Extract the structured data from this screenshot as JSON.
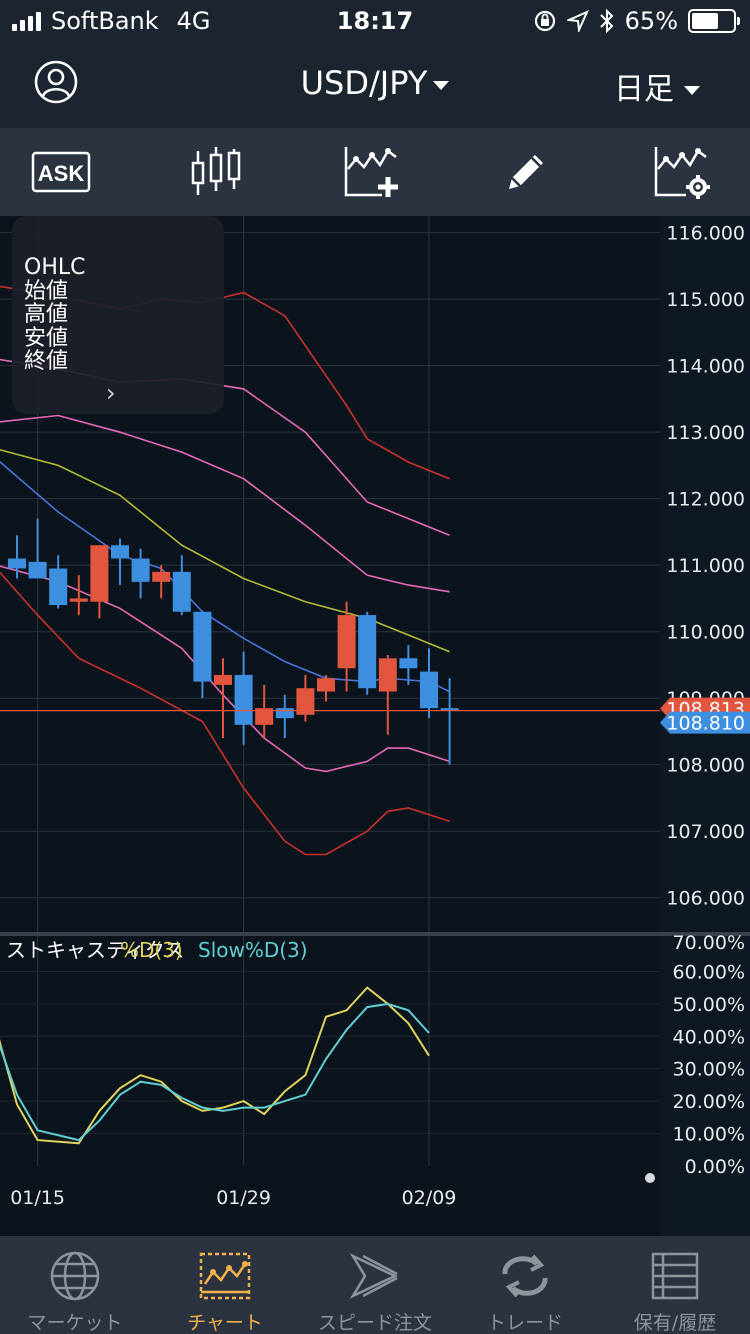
{
  "status_bar": {
    "carrier": "SoftBank",
    "network": "4G",
    "time": "18:17",
    "battery": "65%",
    "battery_level": 0.65
  },
  "header": {
    "pair": "USD/JPY",
    "period": "日足"
  },
  "toolbar": {
    "ask_label": "ASK",
    "tools": [
      "ask-icon",
      "candlestick-icon",
      "add-indicator-icon",
      "pencil-icon",
      "indicator-settings-icon"
    ]
  },
  "ohlc_panel": {
    "header": "OHLC",
    "rows": [
      "始値",
      "高値",
      "安値",
      "終値"
    ],
    "chevron": "›"
  },
  "stoch_legend": {
    "name": "ストキャスティクス",
    "d": "%D(3)",
    "slow": "Slow%D(3)"
  },
  "tabs": [
    {
      "label": "マーケット",
      "icon": "globe-icon"
    },
    {
      "label": "チャート",
      "icon": "chart-icon",
      "active": true
    },
    {
      "label": "スピード注文",
      "icon": "speed-order-icon"
    },
    {
      "label": "トレード",
      "icon": "trade-icon"
    },
    {
      "label": "保有/履歴",
      "icon": "positions-icon"
    }
  ],
  "colors": {
    "up": "#e2553f",
    "down": "#3d8fe0",
    "ma1": "#4a73d8",
    "ma2": "#b7ba36",
    "bollinger": "#e56ab9",
    "bollinger3": "#c9322c",
    "stoch_d": "#e0d35b",
    "stoch_slow": "#5fcfd3",
    "active_tab": "#f2b24b"
  },
  "chart_data": {
    "type": "candlestick",
    "price_axis": {
      "min": 105.5,
      "max": 116.25,
      "ticks": [
        "116.000",
        "115.000",
        "114.000",
        "113.000",
        "112.000",
        "111.000",
        "110.000",
        "109.000",
        "108.000",
        "107.000",
        "106.000"
      ]
    },
    "ask": "108.813",
    "bid": "108.810",
    "x_labels": [
      {
        "index": 1,
        "label": "01/15"
      },
      {
        "index": 11,
        "label": "01/29"
      },
      {
        "index": 20,
        "label": "02/09"
      }
    ],
    "candles": [
      {
        "o": 111.1,
        "h": 111.45,
        "l": 110.8,
        "c": 110.95
      },
      {
        "o": 111.05,
        "h": 111.7,
        "l": 110.8,
        "c": 110.8
      },
      {
        "o": 110.95,
        "h": 111.15,
        "l": 110.35,
        "c": 110.4
      },
      {
        "o": 110.45,
        "h": 110.85,
        "l": 110.25,
        "c": 110.5
      },
      {
        "o": 110.45,
        "h": 111.3,
        "l": 110.2,
        "c": 111.3
      },
      {
        "o": 111.3,
        "h": 111.4,
        "l": 110.7,
        "c": 111.1
      },
      {
        "o": 111.1,
        "h": 111.25,
        "l": 110.5,
        "c": 110.75
      },
      {
        "o": 110.75,
        "h": 111.0,
        "l": 110.5,
        "c": 110.9
      },
      {
        "o": 110.9,
        "h": 111.15,
        "l": 110.25,
        "c": 110.3
      },
      {
        "o": 110.3,
        "h": 110.3,
        "l": 109.0,
        "c": 109.25
      },
      {
        "o": 109.2,
        "h": 109.6,
        "l": 108.4,
        "c": 109.35
      },
      {
        "o": 109.35,
        "h": 109.7,
        "l": 108.3,
        "c": 108.6
      },
      {
        "o": 108.6,
        "h": 109.2,
        "l": 108.4,
        "c": 108.85
      },
      {
        "o": 108.85,
        "h": 109.05,
        "l": 108.4,
        "c": 108.7
      },
      {
        "o": 108.75,
        "h": 109.35,
        "l": 108.65,
        "c": 109.15
      },
      {
        "o": 109.1,
        "h": 109.35,
        "l": 108.95,
        "c": 109.3
      },
      {
        "o": 109.45,
        "h": 110.45,
        "l": 109.1,
        "c": 110.25
      },
      {
        "o": 110.25,
        "h": 110.3,
        "l": 109.05,
        "c": 109.15
      },
      {
        "o": 109.1,
        "h": 109.65,
        "l": 108.45,
        "c": 109.6
      },
      {
        "o": 109.6,
        "h": 109.8,
        "l": 109.2,
        "c": 109.45
      },
      {
        "o": 109.4,
        "h": 109.75,
        "l": 108.7,
        "c": 108.85
      },
      {
        "o": 108.85,
        "h": 109.3,
        "l": 108.0,
        "c": 108.81
      }
    ],
    "overlays": [
      {
        "name": "ma-short",
        "color": "#4a73d8",
        "points": [
          [
            -1,
            112.6
          ],
          [
            2,
            111.8
          ],
          [
            5,
            111.15
          ],
          [
            7,
            110.95
          ],
          [
            9,
            110.3
          ],
          [
            11,
            109.9
          ],
          [
            13,
            109.55
          ],
          [
            15,
            109.3
          ],
          [
            17,
            109.25
          ],
          [
            18,
            109.3
          ],
          [
            20,
            109.25
          ],
          [
            21,
            109.1
          ]
        ]
      },
      {
        "name": "ma-long",
        "color": "#b7ba36",
        "points": [
          [
            -1,
            112.75
          ],
          [
            2,
            112.5
          ],
          [
            5,
            112.05
          ],
          [
            8,
            111.3
          ],
          [
            11,
            110.8
          ],
          [
            14,
            110.45
          ],
          [
            17,
            110.2
          ],
          [
            19,
            109.95
          ],
          [
            21,
            109.7
          ]
        ]
      },
      {
        "name": "bb-upper-1",
        "color": "#e56ab9",
        "points": [
          [
            -1,
            113.15
          ],
          [
            2,
            113.25
          ],
          [
            5,
            113.0
          ],
          [
            8,
            112.7
          ],
          [
            11,
            112.3
          ],
          [
            14,
            111.6
          ],
          [
            17,
            110.85
          ],
          [
            19,
            110.7
          ],
          [
            21,
            110.6
          ]
        ]
      },
      {
        "name": "bb-upper-2",
        "color": "#e56ab9",
        "points": [
          [
            -1,
            114.1
          ],
          [
            2,
            113.95
          ],
          [
            5,
            113.75
          ],
          [
            8,
            113.8
          ],
          [
            11,
            113.65
          ],
          [
            14,
            113.0
          ],
          [
            17,
            111.95
          ],
          [
            19,
            111.7
          ],
          [
            21,
            111.45
          ]
        ]
      },
      {
        "name": "bb-upper-3",
        "color": "#c9322c",
        "points": [
          [
            -1,
            115.2
          ],
          [
            2,
            115.05
          ],
          [
            5,
            114.85
          ],
          [
            7,
            115.0
          ],
          [
            9,
            114.95
          ],
          [
            11,
            115.1
          ],
          [
            13,
            114.75
          ],
          [
            16,
            113.4
          ],
          [
            17,
            112.9
          ],
          [
            19,
            112.55
          ],
          [
            21,
            112.3
          ]
        ]
      },
      {
        "name": "bb-lower-1",
        "color": "#e56ab9",
        "points": [
          [
            -1,
            111.0
          ],
          [
            2,
            110.75
          ],
          [
            5,
            110.35
          ],
          [
            8,
            109.75
          ],
          [
            10,
            109.05
          ],
          [
            12,
            108.4
          ],
          [
            14,
            107.95
          ],
          [
            15,
            107.9
          ],
          [
            17,
            108.05
          ],
          [
            18,
            108.25
          ],
          [
            19,
            108.25
          ],
          [
            21,
            108.05
          ]
        ]
      },
      {
        "name": "bb-lower-2",
        "color": "#c9322c",
        "points": [
          [
            -1,
            110.95
          ],
          [
            1,
            110.25
          ],
          [
            3,
            109.6
          ],
          [
            6,
            109.15
          ],
          [
            9,
            108.65
          ],
          [
            11,
            107.65
          ],
          [
            13,
            106.85
          ],
          [
            14,
            106.65
          ],
          [
            15,
            106.65
          ],
          [
            17,
            107.0
          ],
          [
            18,
            107.3
          ],
          [
            19,
            107.35
          ],
          [
            21,
            107.15
          ]
        ]
      }
    ],
    "stochastic": {
      "range": [
        0,
        70
      ],
      "ticks": [
        "70.00%",
        "60.00%",
        "50.00%",
        "40.00%",
        "30.00%",
        "20.00%",
        "10.00%",
        "0.00%"
      ],
      "d_series": [
        [
          -1,
          42
        ],
        [
          0,
          19
        ],
        [
          1,
          8
        ],
        [
          3,
          7
        ],
        [
          4,
          17
        ],
        [
          5,
          24
        ],
        [
          6,
          28
        ],
        [
          7,
          26
        ],
        [
          8,
          20
        ],
        [
          9,
          17
        ],
        [
          10,
          18
        ],
        [
          11,
          20
        ],
        [
          12,
          16
        ],
        [
          13,
          23
        ],
        [
          14,
          28
        ],
        [
          15,
          46
        ],
        [
          16,
          48
        ],
        [
          17,
          55
        ],
        [
          18,
          50
        ],
        [
          19,
          44
        ],
        [
          20,
          34
        ]
      ],
      "slow_series": [
        [
          -1,
          40
        ],
        [
          0,
          22
        ],
        [
          1,
          11
        ],
        [
          3,
          8
        ],
        [
          4,
          14
        ],
        [
          5,
          22
        ],
        [
          6,
          26
        ],
        [
          7,
          25
        ],
        [
          8,
          21
        ],
        [
          9,
          18
        ],
        [
          10,
          17
        ],
        [
          11,
          18
        ],
        [
          12,
          18
        ],
        [
          13,
          20
        ],
        [
          14,
          22
        ],
        [
          15,
          33
        ],
        [
          16,
          42
        ],
        [
          17,
          49
        ],
        [
          18,
          50
        ],
        [
          19,
          48
        ],
        [
          20,
          41
        ]
      ]
    }
  }
}
